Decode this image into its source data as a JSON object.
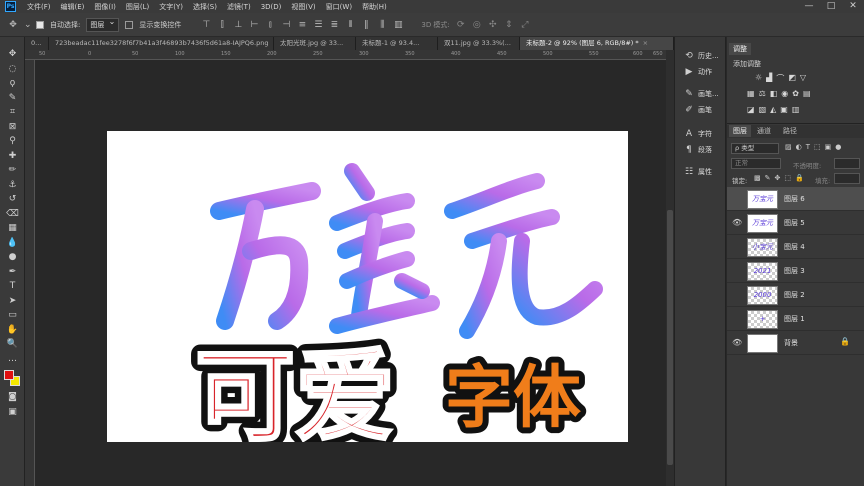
{
  "menubar": {
    "logo": "Ps",
    "items": [
      "文件(F)",
      "编辑(E)",
      "图像(I)",
      "图层(L)",
      "文字(Y)",
      "选择(S)",
      "滤镜(T)",
      "3D(D)",
      "视图(V)",
      "窗口(W)",
      "帮助(H)"
    ],
    "minimize": "—",
    "maximize": "□",
    "close": "✕"
  },
  "options": {
    "auto_select_label": "自动选择:",
    "auto_select_value": "图层",
    "show_transform_label": "显示变换控件",
    "mode_3d_label": "3D 模式:"
  },
  "tabs": [
    {
      "label": "0..."
    },
    {
      "label": "723beadac11fee3278f6f7b41a3f46893b7436f5d61a8-IAJPQ6.png"
    },
    {
      "label": "太阳光斑.jpg @ 33..."
    },
    {
      "label": "未标题-1 @ 93.4..."
    },
    {
      "label": "双11.jpg @ 33.3%(..."
    },
    {
      "label": "未标题-2 @ 92% (图层 6, RGB/8#) *"
    }
  ],
  "ruler": {
    "top_ticks": [
      "50",
      "0",
      "50",
      "100",
      "150",
      "200",
      "250",
      "300",
      "350",
      "400",
      "450",
      "500",
      "550",
      "600",
      "650"
    ]
  },
  "canvas": {
    "handwriting": [
      "万",
      "宝",
      "元"
    ],
    "caption_red": "可爱",
    "caption_orange": "字体"
  },
  "colors": {
    "red": "#d8242a",
    "orange": "#f07d1a",
    "purple": "#b96be8",
    "blue": "#3f8cf5"
  },
  "sidebar": {
    "entries": [
      {
        "icon": "history-icon",
        "glyph": "⟲",
        "label": "历史..."
      },
      {
        "icon": "actions-icon",
        "glyph": "▶",
        "label": "动作"
      },
      {
        "icon": "brush-settings-icon",
        "glyph": "✎",
        "label": "画笔..."
      },
      {
        "icon": "brushes-icon",
        "glyph": "✐",
        "label": "画笔"
      },
      {
        "icon": "character-icon",
        "glyph": "A",
        "label": "字符"
      },
      {
        "icon": "paragraph-icon",
        "glyph": "¶",
        "label": "段落"
      },
      {
        "icon": "properties-icon",
        "glyph": "☷",
        "label": "属性"
      }
    ]
  },
  "adjust_panel": {
    "tab": "调整",
    "add_label": "添加调整"
  },
  "layers_panel": {
    "tabs": [
      "图层",
      "通道",
      "路径"
    ],
    "filter_label": "ρ 类型",
    "blend_mode": "正常",
    "opacity_label": "不透明度:",
    "opacity_value": "",
    "lock_label": "锁定:",
    "fill_label": "填充:",
    "layers": [
      {
        "name": "图层 6",
        "thumb": "万宝元",
        "visible": false,
        "selected": true
      },
      {
        "name": "图层 5",
        "thumb": "万宝元",
        "visible": true,
        "selected": false
      },
      {
        "name": "图层 4",
        "thumb": "小宝元",
        "visible": false,
        "selected": false
      },
      {
        "name": "图层 3",
        "thumb": "2021",
        "visible": false,
        "selected": false
      },
      {
        "name": "图层 2",
        "thumb": "2000",
        "visible": false,
        "selected": false
      },
      {
        "name": "图层 1",
        "thumb": "+",
        "visible": false,
        "selected": false
      },
      {
        "name": "背景",
        "thumb": "",
        "visible": true,
        "selected": false
      }
    ]
  }
}
